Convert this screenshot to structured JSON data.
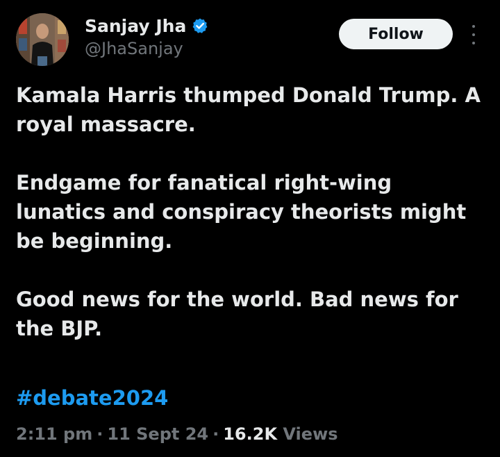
{
  "author": {
    "display_name": "Sanjay Jha",
    "handle": "@JhaSanjay",
    "verified_icon": "verified-badge-icon",
    "avatar_icon": "avatar"
  },
  "actions": {
    "follow_label": "Follow",
    "more_icon": "more-vertical-icon"
  },
  "tweet": {
    "paragraphs": [
      "Kamala Harris thumped Donald Trump. A royal massacre.",
      "Endgame for fanatical right-wing lunatics and conspiracy theorists might be beginning.",
      "Good news for the world. Bad news for the BJP."
    ],
    "hashtag": "#debate2024"
  },
  "meta": {
    "time": "2:11 pm",
    "separator": "·",
    "date": "11 Sept 24",
    "views_count": "16.2K",
    "views_label": "Views"
  },
  "colors": {
    "background": "#000000",
    "text_primary": "#e7e9ea",
    "text_secondary": "#71767b",
    "accent": "#1d9bf0",
    "follow_bg": "#eff3f4"
  }
}
